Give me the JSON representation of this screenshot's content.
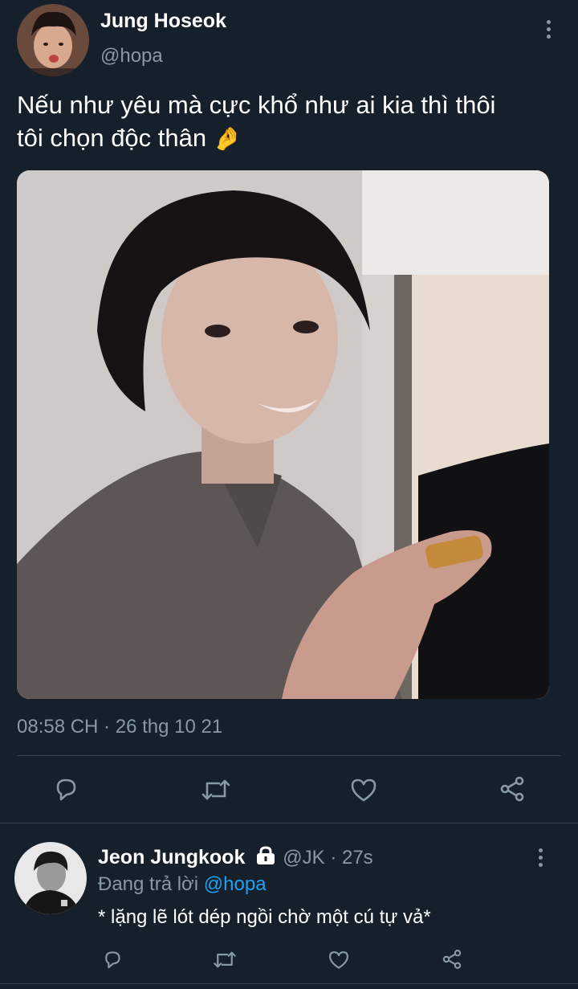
{
  "tweet": {
    "author_name": "Jung Hoseok",
    "author_handle": "@hopa",
    "text_line1": "Nếu như yêu mà cực khổ như ai kia thì thôi",
    "text_line2": "tôi chọn độc thân",
    "text_emoji": "🤌",
    "timestamp": "08:58 CH · 26 thg 10 21",
    "actions": [
      "reply-icon",
      "retweet-icon",
      "like-icon",
      "share-icon"
    ]
  },
  "reply": {
    "author_name": "Jeon Jungkook",
    "author_handle": "@JK",
    "separator": " · ",
    "time": "27s",
    "replying_prefix": "Đang trả lời ",
    "replying_to": "@hopa",
    "text": "* lặng lẽ lót dép ngồi chờ một cú tự vả*",
    "actions": [
      "reply-icon",
      "retweet-icon",
      "like-icon",
      "share-icon"
    ]
  },
  "colors": {
    "background": "#15202b",
    "secondary_text": "#8899a6",
    "divider": "#38444d",
    "link": "#1da1f2"
  }
}
